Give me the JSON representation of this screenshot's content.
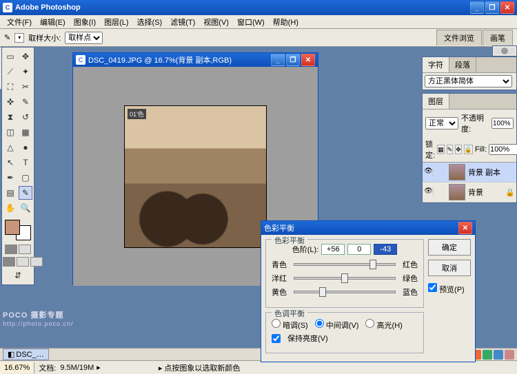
{
  "app": {
    "title": "Adobe Photoshop"
  },
  "menu": [
    "文件(F)",
    "编辑(E)",
    "图象(I)",
    "图层(L)",
    "选择(S)",
    "滤镜(T)",
    "视图(V)",
    "窗口(W)",
    "帮助(H)"
  ],
  "options": {
    "sample_label": "取样大小:",
    "sample_value": "取样点",
    "tab1": "文件浏览",
    "tab2": "画笔"
  },
  "doc": {
    "title": "DSC_0419.JPG @ 16.7%(背景 副本,RGB)",
    "tag": "01'色"
  },
  "char_panel": {
    "tab1": "字符",
    "tab2": "段落",
    "font": "方正黑体简体"
  },
  "layers": {
    "tab": "图层",
    "mode": "正常",
    "opacity_label": "不透明度:",
    "opacity": "100%",
    "lock_label": "锁定:",
    "fill_label": "Fill:",
    "fill": "100%",
    "items": [
      {
        "name": "背景 副本"
      },
      {
        "name": "背景"
      }
    ]
  },
  "dialog": {
    "title": "色彩平衡",
    "group1": "色彩平衡",
    "levels_label": "色阶(L):",
    "l1": "+56",
    "l2": "0",
    "l3": "-43",
    "s1_l": "青色",
    "s1_r": "红色",
    "s2_l": "洋红",
    "s2_r": "绿色",
    "s3_l": "黄色",
    "s3_r": "蓝色",
    "group2": "色调平衡",
    "r1": "暗调(S)",
    "r2": "中间调(V)",
    "r3": "高光(H)",
    "preserve": "保持亮度(V)",
    "ok": "确定",
    "cancel": "取消",
    "preview": "预览(P)"
  },
  "status": {
    "zoom": "16.67%",
    "docsize_label": "文档:",
    "docsize": "9.5M/19M",
    "hint": "点按图象以选取新颜色"
  },
  "task": {
    "item": "DSC_…"
  },
  "watermark": {
    "main": "POCO 摄影专题",
    "sub": "http://photo.poco.cn/"
  }
}
